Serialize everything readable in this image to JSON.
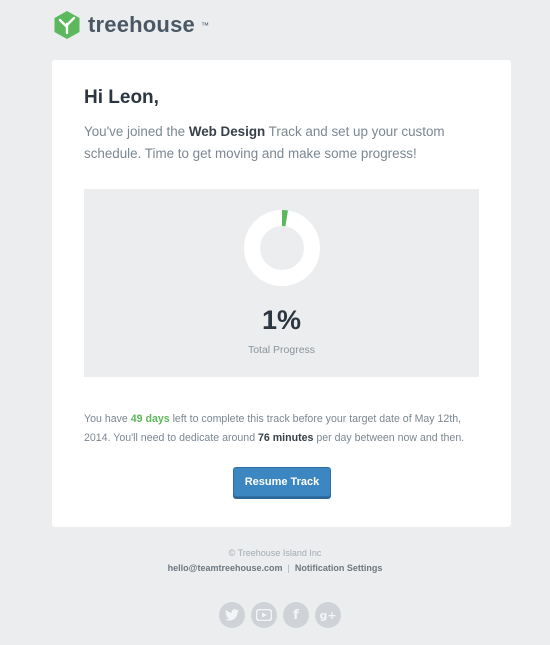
{
  "brand": {
    "name": "treehouse",
    "tm": "™",
    "color": "#5cb85c"
  },
  "email": {
    "greeting": "Hi Leon,",
    "intro_pre": "You've joined the ",
    "track_name": "Web Design",
    "intro_post": " Track and set up your custom schedule. Time to get moving and make some progress!",
    "progress": {
      "value": "1%",
      "fraction": 0.01,
      "label": "Total Progress"
    },
    "summary_pre": "You have ",
    "days": "49 days",
    "summary_mid": " left to complete this track before your target date of May 12th, 2014. You'll need to dedicate around ",
    "minutes": "76 minutes",
    "summary_post": " per day between now and then.",
    "button_label": "Resume Track"
  },
  "footer": {
    "copyright": "© Treehouse Island Inc",
    "email_link": "hello@teamtreehouse.com",
    "separator": "|",
    "settings_link": "Notification Settings",
    "social_icons": [
      "twitter-icon",
      "youtube-icon",
      "facebook-icon",
      "google-plus-icon"
    ]
  },
  "colors": {
    "accent": "#5cb85c",
    "button": "#3c87c2",
    "background": "#ebedef"
  }
}
